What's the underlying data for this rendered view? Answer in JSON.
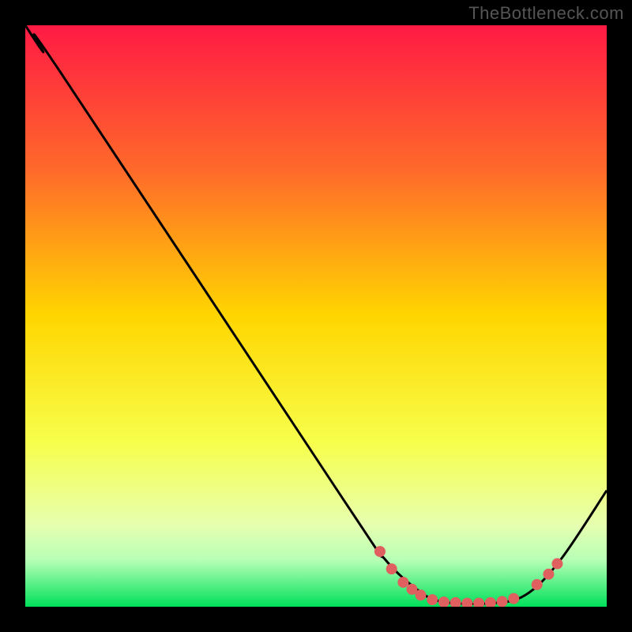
{
  "watermark": "TheBottleneck.com",
  "chart_data": {
    "type": "line",
    "title": "",
    "xlabel": "",
    "ylabel": "",
    "xlim": [
      0,
      100
    ],
    "ylim": [
      0,
      100
    ],
    "gradient_stops": [
      {
        "offset": 0,
        "color": "#ff1a44"
      },
      {
        "offset": 25,
        "color": "#ff6a2a"
      },
      {
        "offset": 50,
        "color": "#ffd600"
      },
      {
        "offset": 72,
        "color": "#f7ff4d"
      },
      {
        "offset": 86,
        "color": "#e6ffb0"
      },
      {
        "offset": 92,
        "color": "#b6ffb6"
      },
      {
        "offset": 100,
        "color": "#00e05a"
      }
    ],
    "series": [
      {
        "name": "curve",
        "stroke": "#000000",
        "points": [
          {
            "x": 0,
            "y": 100
          },
          {
            "x": 3,
            "y": 95.5
          },
          {
            "x": 6,
            "y": 92
          },
          {
            "x": 55,
            "y": 18
          },
          {
            "x": 62,
            "y": 8
          },
          {
            "x": 68,
            "y": 2.5
          },
          {
            "x": 72,
            "y": 0.8
          },
          {
            "x": 80,
            "y": 0.6
          },
          {
            "x": 86,
            "y": 2
          },
          {
            "x": 92,
            "y": 8
          },
          {
            "x": 100,
            "y": 20
          }
        ]
      }
    ],
    "markers": {
      "color": "#e06060",
      "radius": 7,
      "points": [
        {
          "x": 61,
          "y": 9.5
        },
        {
          "x": 63,
          "y": 6.5
        },
        {
          "x": 65,
          "y": 4.2
        },
        {
          "x": 66.5,
          "y": 3.0
        },
        {
          "x": 68,
          "y": 2.0
        },
        {
          "x": 70,
          "y": 1.2
        },
        {
          "x": 72,
          "y": 0.8
        },
        {
          "x": 74,
          "y": 0.7
        },
        {
          "x": 76,
          "y": 0.6
        },
        {
          "x": 78,
          "y": 0.6
        },
        {
          "x": 80,
          "y": 0.7
        },
        {
          "x": 82,
          "y": 0.9
        },
        {
          "x": 84,
          "y": 1.4
        },
        {
          "x": 88,
          "y": 3.8
        },
        {
          "x": 90,
          "y": 5.6
        },
        {
          "x": 91.5,
          "y": 7.4
        }
      ]
    }
  }
}
